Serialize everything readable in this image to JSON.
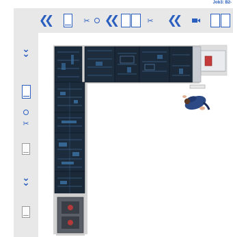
{
  "header": {
    "job_label": "Job3: B2-"
  },
  "toolbar": {
    "icons": [
      "double-chevron-left-icon",
      "single-panel-icon",
      "scissors-icon",
      "circle-icon",
      "double-chevron-left-icon",
      "double-panel-icon",
      "scissors-icon",
      "double-chevron-left-icon",
      "camera-icon",
      "double-panel-icon"
    ]
  },
  "sidebar": {
    "icons": [
      "double-chevron-down-icon",
      "single-panel-icon",
      "circle-icon",
      "scissors-icon",
      "gray-panel-icon",
      "double-chevron-down-icon",
      "gray-panel-icon"
    ]
  },
  "colors": {
    "accent": "#2a5fc0",
    "toolbar_bg": "#e8e8e8",
    "cabinet": "#1b2a3a",
    "wall": "#d4d4d4"
  }
}
